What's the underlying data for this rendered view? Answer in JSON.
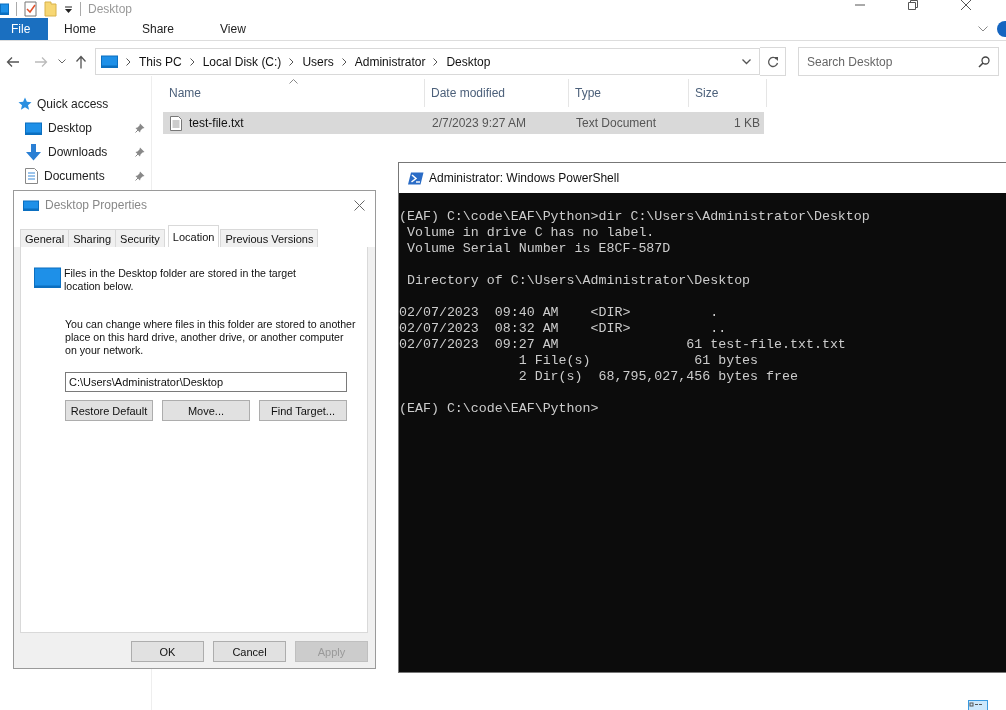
{
  "explorer": {
    "title": "Desktop",
    "ribbon_tabs": [
      {
        "label": "File",
        "kind": "file"
      },
      {
        "label": "Home",
        "kind": "tab"
      },
      {
        "label": "Share",
        "kind": "tab"
      },
      {
        "label": "View",
        "kind": "tab"
      }
    ],
    "breadcrumb": [
      "This PC",
      "Local Disk (C:)",
      "Users",
      "Administrator",
      "Desktop"
    ],
    "search": {
      "placeholder": "Search Desktop"
    },
    "quick_access": {
      "label": "Quick access",
      "items": [
        {
          "label": "Desktop",
          "kind": "desktop",
          "pinned": true
        },
        {
          "label": "Downloads",
          "kind": "downloads",
          "pinned": true
        },
        {
          "label": "Documents",
          "kind": "documents",
          "pinned": true
        }
      ]
    },
    "columns": [
      "Name",
      "Date modified",
      "Type",
      "Size"
    ],
    "files": [
      {
        "name": "test-file.txt",
        "date_modified": "2/7/2023 9:27 AM",
        "type": "Text Document",
        "size": "1 KB",
        "selected": true
      }
    ]
  },
  "properties_dialog": {
    "title": "Desktop Properties",
    "tabs": [
      {
        "label": "General",
        "selected": false
      },
      {
        "label": "Sharing",
        "selected": false
      },
      {
        "label": "Security",
        "selected": false
      },
      {
        "label": "Location",
        "selected": true
      },
      {
        "label": "Previous Versions",
        "selected": false
      }
    ],
    "description": "Files in the Desktop folder are stored in the target location below.",
    "note": "You can change where files in this folder are stored to another place on this hard drive, another drive, or another computer on your network.",
    "path": "C:\\Users\\Administrator\\Desktop",
    "buttons": [
      {
        "label": "Restore Default",
        "disabled": false
      },
      {
        "label": "Move...",
        "disabled": false
      },
      {
        "label": "Find Target...",
        "disabled": false
      }
    ],
    "footer_buttons": [
      {
        "label": "OK",
        "disabled": false
      },
      {
        "label": "Cancel",
        "disabled": false
      },
      {
        "label": "Apply",
        "disabled": true
      }
    ]
  },
  "powershell": {
    "title": "Administrator: Windows PowerShell",
    "output": "(EAF) C:\\code\\EAF\\Python>dir C:\\Users\\Administrator\\Desktop\n Volume in drive C has no label.\n Volume Serial Number is E8CF-587D\n\n Directory of C:\\Users\\Administrator\\Desktop\n\n02/07/2023  09:40 AM    <DIR>          .\n02/07/2023  08:32 AM    <DIR>          ..\n02/07/2023  09:27 AM                61 test-file.txt.txt\n               1 File(s)             61 bytes\n               2 Dir(s)  68,795,027,456 bytes free\n\n(EAF) C:\\code\\EAF\\Python>"
  }
}
